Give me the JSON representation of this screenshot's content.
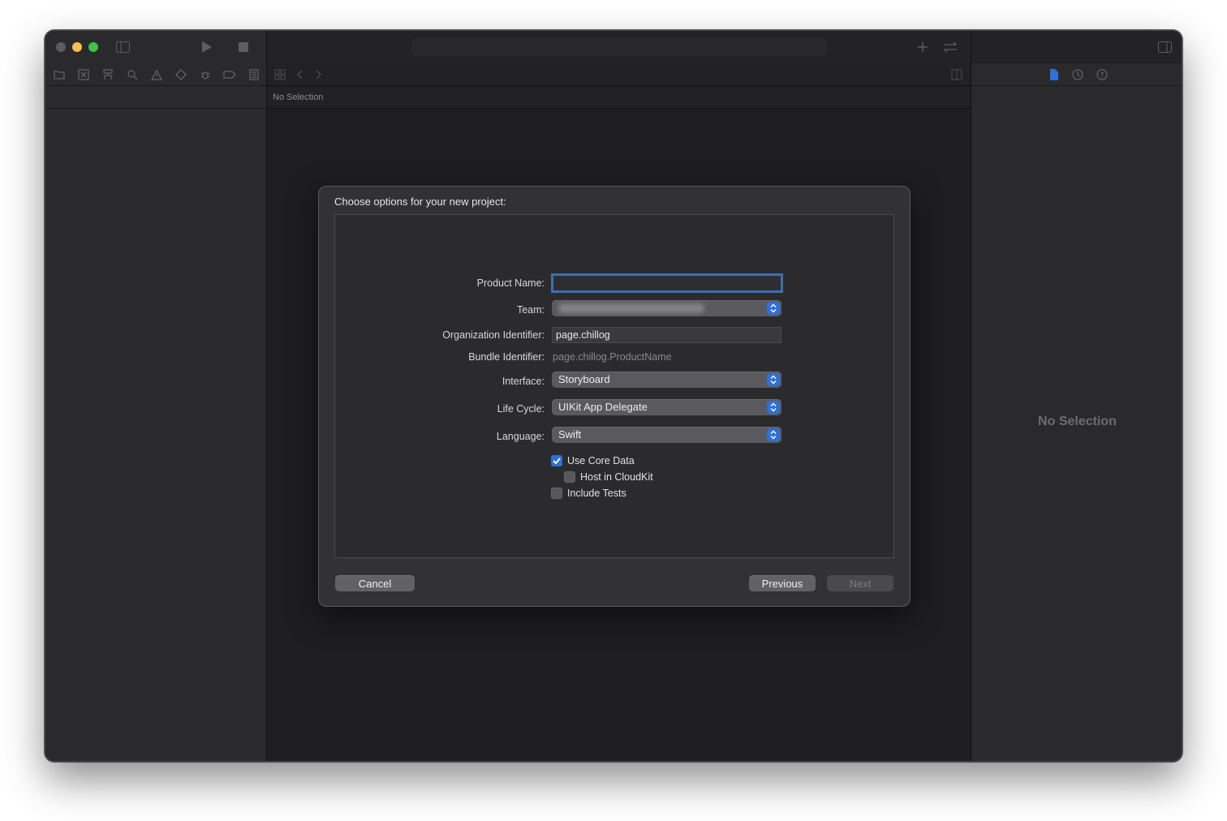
{
  "editor": {
    "breadcrumb": "No Selection"
  },
  "inspector": {
    "empty_state": "No Selection"
  },
  "dialog": {
    "title": "Choose options for your new project:",
    "fields": {
      "product_name": {
        "label": "Product Name:",
        "value": ""
      },
      "team": {
        "label": "Team:",
        "value": "Minkyu Chi (Personal Team)"
      },
      "organization_identifier": {
        "label": "Organization Identifier:",
        "value": "page.chillog"
      },
      "bundle_identifier": {
        "label": "Bundle Identifier:",
        "value": "page.chillog.ProductName"
      },
      "interface": {
        "label": "Interface:",
        "value": "Storyboard"
      },
      "life_cycle": {
        "label": "Life Cycle:",
        "value": "UIKit App Delegate"
      },
      "language": {
        "label": "Language:",
        "value": "Swift"
      }
    },
    "checkboxes": {
      "use_core_data": {
        "label": "Use Core Data",
        "checked": true
      },
      "host_in_cloudkit": {
        "label": "Host in CloudKit",
        "checked": false
      },
      "include_tests": {
        "label": "Include Tests",
        "checked": false
      }
    },
    "buttons": {
      "cancel": "Cancel",
      "previous": "Previous",
      "next": "Next"
    }
  },
  "colors": {
    "accent": "#2f70d8",
    "window_bg": "#1e1e20",
    "sheet_bg": "#323234",
    "close_light": "#5d5d60",
    "minimize_light": "#f4bf4f",
    "zoom_light": "#3ec33f"
  },
  "icons": {
    "navigator_tabs": [
      "folder-icon",
      "source-control-icon",
      "symbol-icon",
      "search-icon",
      "warning-icon",
      "test-icon",
      "debug-icon",
      "breakpoint-icon",
      "report-icon"
    ],
    "inspector_tabs": [
      "file-inspector-icon",
      "history-icon",
      "help-icon"
    ]
  }
}
